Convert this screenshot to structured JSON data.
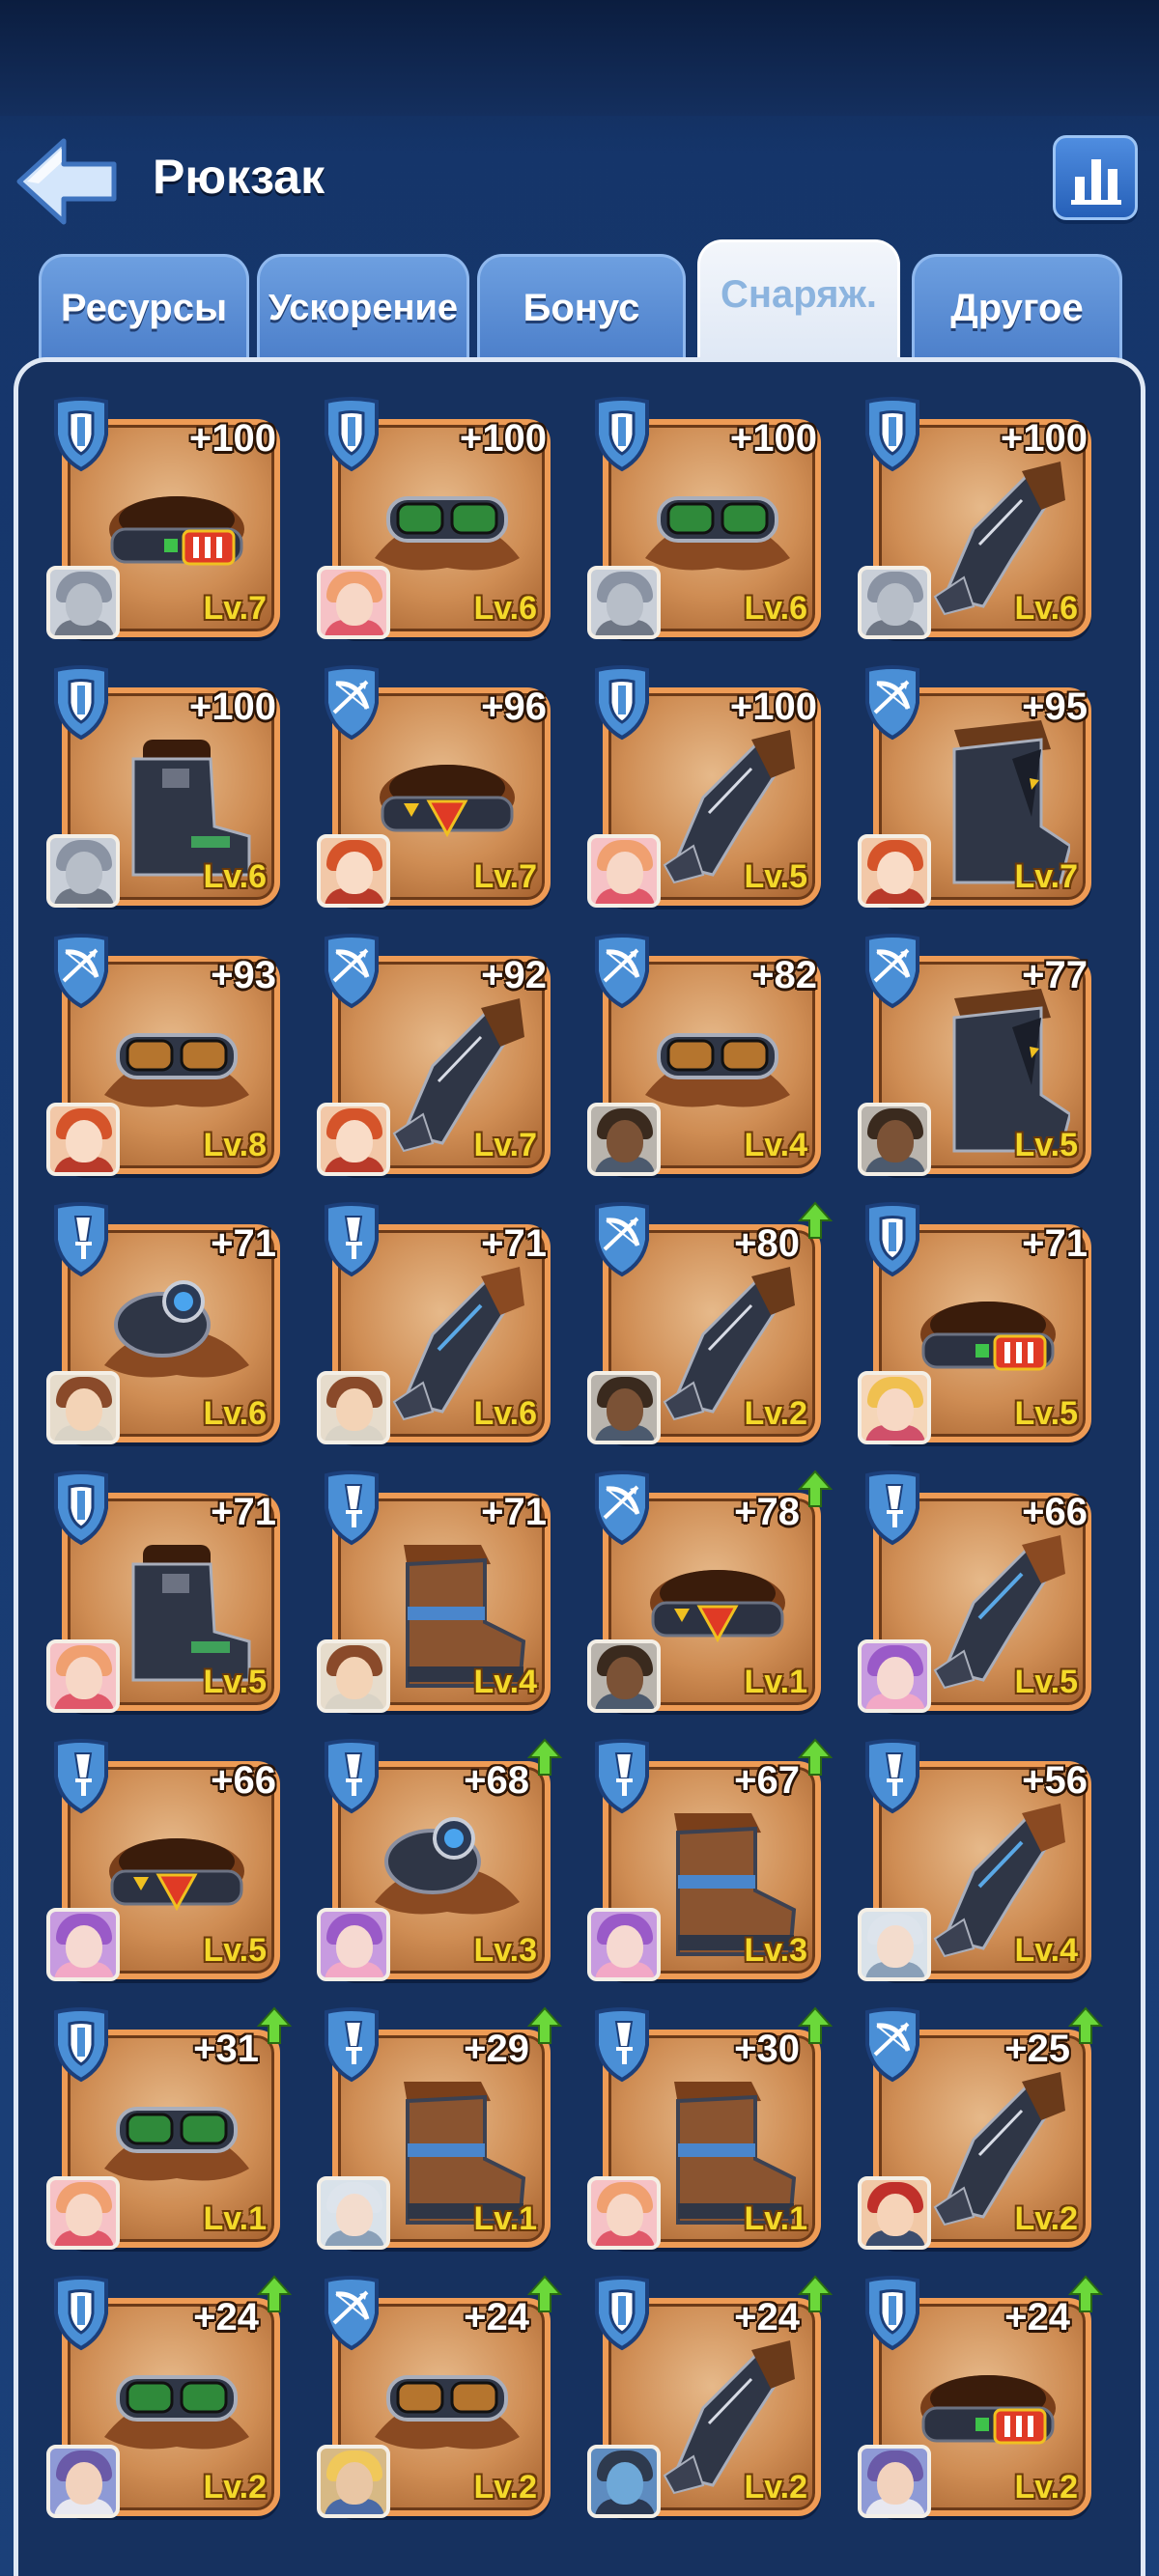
{
  "header": {
    "title": "Рюкзак"
  },
  "tabs": [
    {
      "label": "Ресурсы",
      "active": false
    },
    {
      "label": "Ускорение",
      "active": false
    },
    {
      "label": "Бонус",
      "active": false
    },
    {
      "label": "Снаряж.",
      "active": true
    },
    {
      "label": "Другое",
      "active": false
    }
  ],
  "colors": {
    "accent": "#ee9b55",
    "level": "#f4d92a",
    "upgrade": "#6bd83a",
    "tab_active_text": "#8cb4df"
  },
  "items": [
    {
      "type": "shield",
      "gear": "belt",
      "power": "+100",
      "level": "Lv.7",
      "upgrade": false,
      "hero": "grey"
    },
    {
      "type": "shield",
      "gear": "goggles-green",
      "power": "+100",
      "level": "Lv.6",
      "upgrade": false,
      "hero": "pink"
    },
    {
      "type": "shield",
      "gear": "goggles-green",
      "power": "+100",
      "level": "Lv.6",
      "upgrade": false,
      "hero": "grey"
    },
    {
      "type": "shield",
      "gear": "gauntlet",
      "power": "+100",
      "level": "Lv.6",
      "upgrade": false,
      "hero": "grey"
    },
    {
      "type": "shield",
      "gear": "boot",
      "power": "+100",
      "level": "Lv.6",
      "upgrade": false,
      "hero": "grey"
    },
    {
      "type": "bow",
      "gear": "belt-red",
      "power": "+96",
      "level": "Lv.7",
      "upgrade": false,
      "hero": "redhair"
    },
    {
      "type": "shield",
      "gear": "gauntlet",
      "power": "+100",
      "level": "Lv.5",
      "upgrade": false,
      "hero": "pink"
    },
    {
      "type": "bow",
      "gear": "boot-dark",
      "power": "+95",
      "level": "Lv.7",
      "upgrade": false,
      "hero": "redhair"
    },
    {
      "type": "bow",
      "gear": "goggles-brown",
      "power": "+93",
      "level": "Lv.8",
      "upgrade": false,
      "hero": "redhair"
    },
    {
      "type": "bow",
      "gear": "gauntlet",
      "power": "+92",
      "level": "Lv.7",
      "upgrade": false,
      "hero": "redhair"
    },
    {
      "type": "bow",
      "gear": "goggles-brown",
      "power": "+82",
      "level": "Lv.4",
      "upgrade": false,
      "hero": "dark"
    },
    {
      "type": "bow",
      "gear": "boot-dark",
      "power": "+77",
      "level": "Lv.5",
      "upgrade": false,
      "hero": "dark"
    },
    {
      "type": "sword",
      "gear": "goggles-blue",
      "power": "+71",
      "level": "Lv.6",
      "upgrade": false,
      "hero": "dwarf"
    },
    {
      "type": "sword",
      "gear": "gauntlet-blue",
      "power": "+71",
      "level": "Lv.6",
      "upgrade": false,
      "hero": "dwarf"
    },
    {
      "type": "bow",
      "gear": "gauntlet",
      "power": "+80",
      "level": "Lv.2",
      "upgrade": true,
      "hero": "dark"
    },
    {
      "type": "shield",
      "gear": "belt",
      "power": "+71",
      "level": "Lv.5",
      "upgrade": false,
      "hero": "queen"
    },
    {
      "type": "shield",
      "gear": "boot",
      "power": "+71",
      "level": "Lv.5",
      "upgrade": false,
      "hero": "pink"
    },
    {
      "type": "sword",
      "gear": "boot-blue",
      "power": "+71",
      "level": "Lv.4",
      "upgrade": false,
      "hero": "dwarf"
    },
    {
      "type": "bow",
      "gear": "belt-red",
      "power": "+78",
      "level": "Lv.1",
      "upgrade": true,
      "hero": "dark"
    },
    {
      "type": "sword",
      "gear": "gauntlet-blue",
      "power": "+66",
      "level": "Lv.5",
      "upgrade": false,
      "hero": "purple"
    },
    {
      "type": "sword",
      "gear": "belt-red",
      "power": "+66",
      "level": "Lv.5",
      "upgrade": false,
      "hero": "purple"
    },
    {
      "type": "sword",
      "gear": "goggles-blue",
      "power": "+68",
      "level": "Lv.3",
      "upgrade": true,
      "hero": "purple"
    },
    {
      "type": "sword",
      "gear": "boot-blue",
      "power": "+67",
      "level": "Lv.3",
      "upgrade": true,
      "hero": "purple"
    },
    {
      "type": "sword",
      "gear": "gauntlet-blue",
      "power": "+56",
      "level": "Lv.4",
      "upgrade": false,
      "hero": "silver"
    },
    {
      "type": "shield",
      "gear": "goggles-green",
      "power": "+31",
      "level": "Lv.1",
      "upgrade": true,
      "hero": "pink"
    },
    {
      "type": "sword",
      "gear": "boot-blue",
      "power": "+29",
      "level": "Lv.1",
      "upgrade": true,
      "hero": "silver"
    },
    {
      "type": "sword",
      "gear": "boot-blue",
      "power": "+30",
      "level": "Lv.1",
      "upgrade": true,
      "hero": "pink"
    },
    {
      "type": "bow",
      "gear": "gauntlet",
      "power": "+25",
      "level": "Lv.2",
      "upgrade": true,
      "hero": "pirate"
    },
    {
      "type": "shield",
      "gear": "goggles-green",
      "power": "+24",
      "level": "Lv.2",
      "upgrade": true,
      "hero": "viking"
    },
    {
      "type": "bow",
      "gear": "goggles-brown",
      "power": "+24",
      "level": "Lv.2",
      "upgrade": true,
      "hero": "blonde"
    },
    {
      "type": "shield",
      "gear": "gauntlet",
      "power": "+24",
      "level": "Lv.2",
      "upgrade": true,
      "hero": "diver"
    },
    {
      "type": "shield",
      "gear": "belt",
      "power": "+24",
      "level": "Lv.2",
      "upgrade": true,
      "hero": "viking"
    }
  ]
}
